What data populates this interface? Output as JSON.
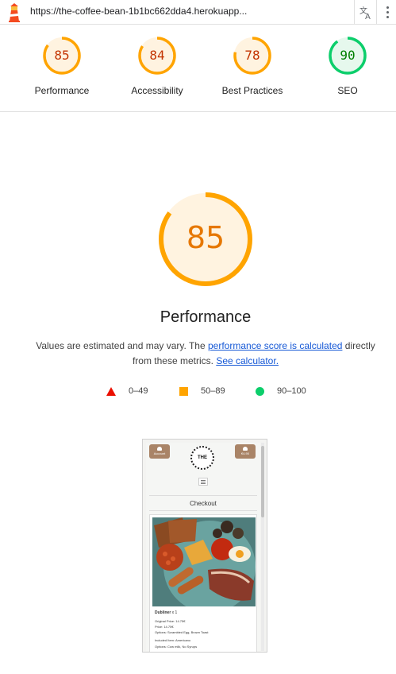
{
  "topbar": {
    "url": "https://the-coffee-bean-1b1bc662dda4.herokuapp..."
  },
  "scores": [
    {
      "label": "Performance",
      "value": "85",
      "fraction": 0.85,
      "color": "#ffa400",
      "text_color": "#c33300"
    },
    {
      "label": "Accessibility",
      "value": "84",
      "fraction": 0.84,
      "color": "#ffa400",
      "text_color": "#c33300"
    },
    {
      "label": "Best Practices",
      "value": "78",
      "fraction": 0.78,
      "color": "#ffa400",
      "text_color": "#c33300"
    },
    {
      "label": "SEO",
      "value": "90",
      "fraction": 0.9,
      "color": "#0cce6b",
      "text_color": "#008000"
    }
  ],
  "main": {
    "score": "85",
    "fraction": 0.85,
    "title": "Performance",
    "desc_prefix": "Values are estimated and may vary. The ",
    "desc_link1": "performance score is calculated",
    "desc_middle": " directly from these metrics. ",
    "desc_link2": "See calculator."
  },
  "legend": {
    "fail": "0–49",
    "average": "50–89",
    "pass": "90–100"
  },
  "colors": {
    "fail": "#eb0f00",
    "average": "#ffa400",
    "pass": "#0cce6b",
    "gauge_bg_orange": "#fff3e0",
    "gauge_bg_green": "#e6f8ed"
  },
  "thumbnail": {
    "left_button": "Account",
    "right_button": "€4.90",
    "logo": "THE",
    "heading": "Checkout",
    "item_title": "Dubliner",
    "item_qty": "x 1",
    "line1": "Original Price: 14.75€",
    "line2": "Price: 14.75€",
    "line3": "Options: Scrambled Egg, Brown Toast",
    "line4": "Included Item: Americano",
    "line5": "Options: Cow milk, No Syrups"
  }
}
